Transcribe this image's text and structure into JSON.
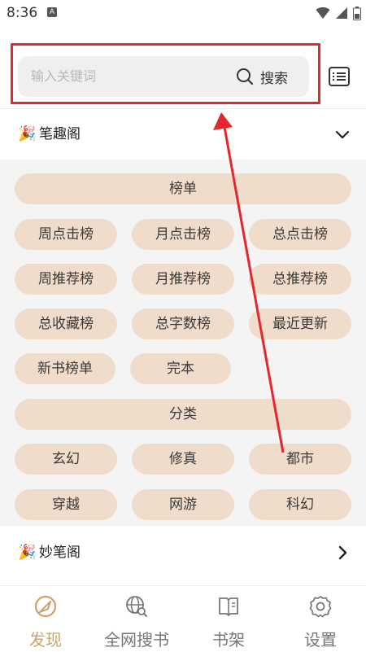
{
  "status_bar": {
    "time": "8:36",
    "notification_icon": "A"
  },
  "search": {
    "placeholder": "输入关键词",
    "button_label": "搜索",
    "search_icon": "search-icon",
    "menu_icon": "list-menu-icon"
  },
  "sections": [
    {
      "emoji": "🎉",
      "title": "笔趣阁",
      "state": "expanded",
      "chevron_icon": "chevron-down-icon"
    },
    {
      "emoji": "🎉",
      "title": "妙笔阁",
      "state": "collapsed",
      "chevron_icon": "chevron-right-icon"
    }
  ],
  "rank_header": "榜单",
  "rank_rows": [
    [
      "周点击榜",
      "月点击榜",
      "总点击榜"
    ],
    [
      "周推荐榜",
      "月推荐榜",
      "总推荐榜"
    ],
    [
      "总收藏榜",
      "总字数榜",
      "最近更新"
    ],
    [
      "新书榜单",
      "完本"
    ]
  ],
  "category_header": "分类",
  "category_rows": [
    [
      "玄幻",
      "修真",
      "都市"
    ],
    [
      "穿越",
      "网游",
      "科幻"
    ]
  ],
  "bottom_nav": [
    {
      "label": "发现",
      "icon": "compass-icon",
      "active": true
    },
    {
      "label": "全网搜书",
      "icon": "globe-search-icon",
      "active": false
    },
    {
      "label": "书架",
      "icon": "book-icon",
      "active": false
    },
    {
      "label": "设置",
      "icon": "gear-icon",
      "active": false
    }
  ],
  "colors": {
    "pill_background": "#efdcca",
    "panel_background": "#f4f4f4",
    "active_tab": "#c9a36b",
    "annotation_red": "#e6262c"
  }
}
